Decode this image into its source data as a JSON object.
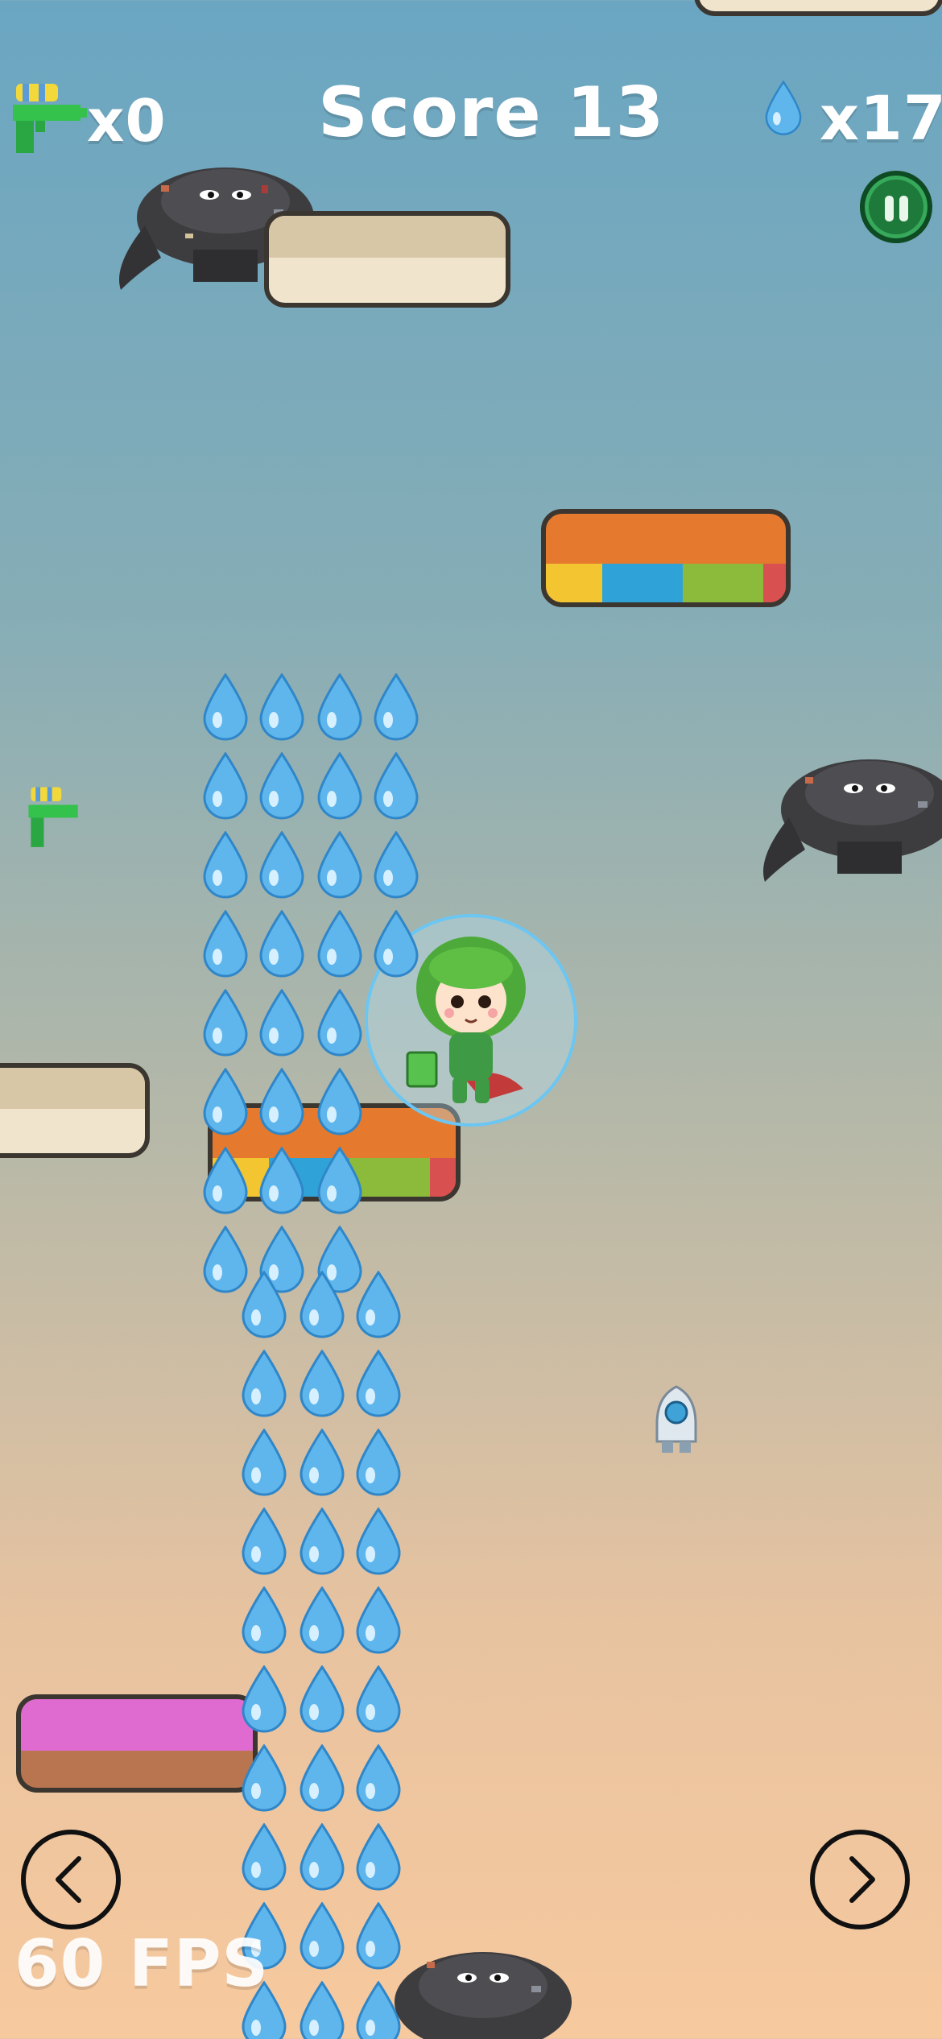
{
  "hud": {
    "gun_count": "x0",
    "score": "Score 13",
    "drop_count": "x17",
    "fps": "60 FPS"
  },
  "icons": {
    "gun": "water-gun-icon",
    "drop": "water-drop-icon",
    "pause": "pause-icon",
    "left": "left-arrow-icon",
    "right": "right-arrow-icon"
  },
  "colors": {
    "sky_top": "#6aa6c2",
    "sky_bottom": "#f7c99e",
    "hud_text": "#ffffff",
    "pause_green": "#1e7a3a",
    "drop_blue": "#5fb6ec"
  }
}
